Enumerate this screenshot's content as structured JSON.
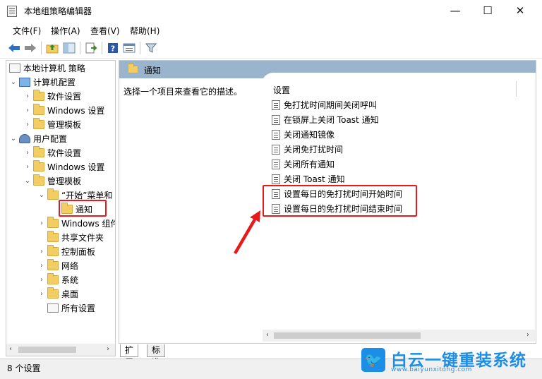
{
  "window": {
    "title": "本地组策略编辑器",
    "minimize": "—",
    "maximize": "☐",
    "close": "✕"
  },
  "menu": [
    "文件(F)",
    "操作(A)",
    "查看(V)",
    "帮助(H)"
  ],
  "toolbar": {
    "icons": [
      "back-icon",
      "forward-icon",
      "up-folder-icon",
      "show-hide-tree-icon",
      "export-list-icon",
      "help-icon",
      "properties-icon",
      "filter-icon"
    ]
  },
  "tree": {
    "root": "本地计算机 策略",
    "computer_config": "计算机配置",
    "cc_software": "软件设置",
    "cc_windows": "Windows 设置",
    "cc_admin": "管理模板",
    "user_config": "用户配置",
    "uc_software": "软件设置",
    "uc_windows": "Windows 设置",
    "uc_admin": "管理模板",
    "start_menu": "“开始”菜单和",
    "notifications": "通知",
    "windows_components": "Windows 组件",
    "shared_folders": "共享文件夹",
    "control_panel": "控制面板",
    "network": "网络",
    "system": "系统",
    "desktop": "桌面",
    "all_settings": "所有设置"
  },
  "content": {
    "header": "通知",
    "description": "选择一个项目来查看它的描述。",
    "column_header": "设置",
    "settings": [
      "免打扰时间期间关闭呼叫",
      "在锁屏上关闭 Toast 通知",
      "关闭通知镜像",
      "关闭免打扰时间",
      "关闭所有通知",
      "关闭 Toast 通知",
      "设置每日的免打扰时间开始时间",
      "设置每日的免打扰时间结束时间"
    ]
  },
  "tabs": [
    "扩展",
    "标准"
  ],
  "status": "8 个设置",
  "watermark": {
    "brand": "白云一键重装系统",
    "url": "www.baiyunxitong.com"
  },
  "colors": {
    "highlight": "#e8191b",
    "header_bar": "#9ab4ce",
    "brand_blue": "#1d8ee6"
  }
}
